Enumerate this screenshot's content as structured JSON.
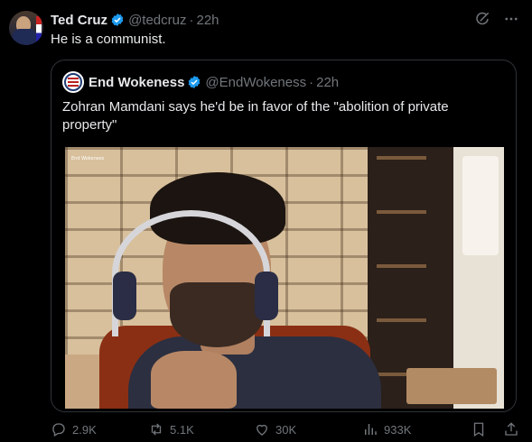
{
  "tweet": {
    "author_name": "Ted Cruz",
    "handle": "@tedcruz",
    "time": "22h",
    "separator": "·",
    "text": "He is a communist."
  },
  "quote": {
    "author_name": "End Wokeness",
    "handle": "@EndWokeness",
    "time": "22h",
    "separator": "·",
    "text": "Zohran Mamdani says he'd be in favor of the \"abolition of private property\"",
    "video_watermark": "End Wokeness"
  },
  "actions": {
    "replies": "2.9K",
    "reposts": "5.1K",
    "likes": "30K",
    "views": "933K"
  },
  "icons": [
    "verified-badge-icon",
    "grok-icon",
    "more-icon",
    "reply-icon",
    "repost-icon",
    "like-icon",
    "views-icon",
    "bookmark-icon",
    "share-icon"
  ],
  "colors": {
    "background": "#000000",
    "text": "#e7e9ea",
    "muted": "#71767b",
    "verified": "#1d9bf0",
    "border": "#2f3336"
  }
}
